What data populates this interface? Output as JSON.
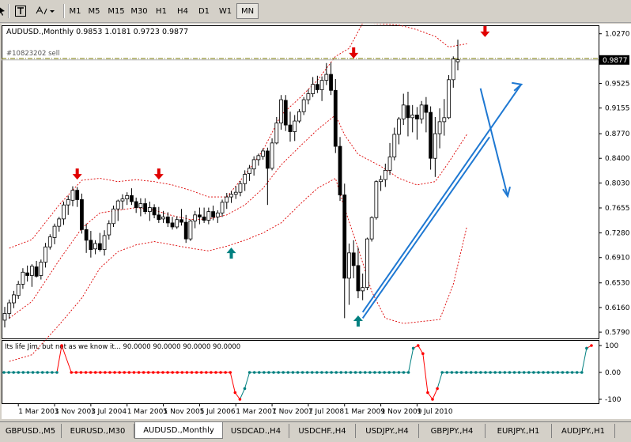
{
  "toolbar": {
    "timeframes": [
      "M1",
      "M5",
      "M15",
      "M30",
      "H1",
      "H4",
      "D1",
      "W1",
      "MN"
    ],
    "active_timeframe": "MN"
  },
  "chart_header": {
    "symbol": "AUDUSD.,Monthly",
    "ohlc": "0.9853 1.0181 0.9723 0.9877",
    "order_label": "#10823202 sell",
    "current_price": "0.9877"
  },
  "indicator": {
    "label": "Its life Jim, but not as we know it...",
    "values": "90.0000 90.0000 90.0000 90.0000"
  },
  "chart_data": {
    "type": "candlestick",
    "price_axis_ticks": [
      "1.0270",
      "0.9877",
      "0.9525",
      "0.9155",
      "0.8770",
      "0.8400",
      "0.8030",
      "0.7655",
      "0.7280",
      "0.6910",
      "0.6530",
      "0.6160",
      "0.5790"
    ],
    "indicator_axis_ticks": [
      "100",
      "0.00",
      "-100"
    ],
    "x_tick_labels": [
      "1 Mar 2003",
      "1 Nov 2003",
      "1 Jul 2004",
      "1 Mar 2005",
      "1 Nov 2005",
      "1 Jul 2006",
      "1 Mar 2007",
      "1 Nov 2007",
      "1 Jul 2008",
      "1 Mar 2009",
      "1 Nov 2009",
      "1 Jul 2010"
    ],
    "start_month": "2002-12",
    "candles": [
      [
        0.597,
        0.617,
        0.586,
        0.607
      ],
      [
        0.607,
        0.628,
        0.599,
        0.623
      ],
      [
        0.623,
        0.641,
        0.615,
        0.635
      ],
      [
        0.634,
        0.656,
        0.629,
        0.651
      ],
      [
        0.651,
        0.675,
        0.644,
        0.669
      ],
      [
        0.668,
        0.679,
        0.655,
        0.664
      ],
      [
        0.664,
        0.681,
        0.647,
        0.678
      ],
      [
        0.677,
        0.686,
        0.661,
        0.663
      ],
      [
        0.664,
        0.688,
        0.658,
        0.684
      ],
      [
        0.684,
        0.713,
        0.676,
        0.707
      ],
      [
        0.707,
        0.726,
        0.703,
        0.722
      ],
      [
        0.721,
        0.742,
        0.711,
        0.738
      ],
      [
        0.738,
        0.752,
        0.73,
        0.749
      ],
      [
        0.749,
        0.775,
        0.74,
        0.77
      ],
      [
        0.77,
        0.784,
        0.755,
        0.778
      ],
      [
        0.777,
        0.798,
        0.768,
        0.792
      ],
      [
        0.792,
        0.797,
        0.767,
        0.778
      ],
      [
        0.778,
        0.787,
        0.727,
        0.733
      ],
      [
        0.733,
        0.742,
        0.698,
        0.717
      ],
      [
        0.717,
        0.731,
        0.691,
        0.703
      ],
      [
        0.704,
        0.717,
        0.696,
        0.712
      ],
      [
        0.712,
        0.728,
        0.7,
        0.703
      ],
      [
        0.703,
        0.732,
        0.694,
        0.724
      ],
      [
        0.725,
        0.747,
        0.718,
        0.742
      ],
      [
        0.742,
        0.769,
        0.737,
        0.764
      ],
      [
        0.764,
        0.778,
        0.746,
        0.776
      ],
      [
        0.776,
        0.786,
        0.763,
        0.779
      ],
      [
        0.779,
        0.789,
        0.77,
        0.784
      ],
      [
        0.784,
        0.795,
        0.77,
        0.775
      ],
      [
        0.775,
        0.781,
        0.758,
        0.766
      ],
      [
        0.766,
        0.78,
        0.753,
        0.772
      ],
      [
        0.772,
        0.78,
        0.756,
        0.76
      ],
      [
        0.76,
        0.775,
        0.746,
        0.766
      ],
      [
        0.766,
        0.771,
        0.75,
        0.755
      ],
      [
        0.755,
        0.767,
        0.743,
        0.748
      ],
      [
        0.749,
        0.761,
        0.743,
        0.752
      ],
      [
        0.752,
        0.759,
        0.737,
        0.743
      ],
      [
        0.743,
        0.752,
        0.733,
        0.737
      ],
      [
        0.737,
        0.753,
        0.734,
        0.748
      ],
      [
        0.748,
        0.764,
        0.739,
        0.744
      ],
      [
        0.744,
        0.755,
        0.713,
        0.719
      ],
      [
        0.719,
        0.748,
        0.716,
        0.746
      ],
      [
        0.746,
        0.761,
        0.735,
        0.755
      ],
      [
        0.755,
        0.766,
        0.741,
        0.752
      ],
      [
        0.752,
        0.766,
        0.743,
        0.747
      ],
      [
        0.747,
        0.766,
        0.741,
        0.76
      ],
      [
        0.76,
        0.769,
        0.747,
        0.752
      ],
      [
        0.752,
        0.762,
        0.743,
        0.758
      ],
      [
        0.758,
        0.778,
        0.752,
        0.774
      ],
      [
        0.774,
        0.788,
        0.764,
        0.782
      ],
      [
        0.782,
        0.791,
        0.773,
        0.786
      ],
      [
        0.786,
        0.798,
        0.779,
        0.789
      ],
      [
        0.789,
        0.806,
        0.783,
        0.802
      ],
      [
        0.802,
        0.822,
        0.791,
        0.816
      ],
      [
        0.817,
        0.83,
        0.806,
        0.825
      ],
      [
        0.824,
        0.843,
        0.814,
        0.838
      ],
      [
        0.838,
        0.847,
        0.829,
        0.844
      ],
      [
        0.843,
        0.855,
        0.838,
        0.851
      ],
      [
        0.851,
        0.856,
        0.77,
        0.825
      ],
      [
        0.825,
        0.87,
        0.822,
        0.863
      ],
      [
        0.863,
        0.902,
        0.861,
        0.893
      ],
      [
        0.893,
        0.935,
        0.883,
        0.928
      ],
      [
        0.927,
        0.935,
        0.881,
        0.89
      ],
      [
        0.89,
        0.91,
        0.865,
        0.88
      ],
      [
        0.88,
        0.905,
        0.866,
        0.896
      ],
      [
        0.896,
        0.914,
        0.893,
        0.91
      ],
      [
        0.91,
        0.932,
        0.905,
        0.928
      ],
      [
        0.928,
        0.944,
        0.921,
        0.937
      ],
      [
        0.937,
        0.962,
        0.932,
        0.951
      ],
      [
        0.951,
        0.964,
        0.938,
        0.943
      ],
      [
        0.943,
        0.963,
        0.926,
        0.957
      ],
      [
        0.957,
        0.983,
        0.95,
        0.966
      ],
      [
        0.966,
        0.984,
        0.935,
        0.942
      ],
      [
        0.942,
        0.959,
        0.848,
        0.858
      ],
      [
        0.858,
        0.872,
        0.776,
        0.785
      ],
      [
        0.785,
        0.802,
        0.6,
        0.66
      ],
      [
        0.66,
        0.712,
        0.62,
        0.698
      ],
      [
        0.698,
        0.717,
        0.66,
        0.679
      ],
      [
        0.679,
        0.706,
        0.63,
        0.641
      ],
      [
        0.641,
        0.667,
        0.627,
        0.646
      ],
      [
        0.646,
        0.721,
        0.642,
        0.719
      ],
      [
        0.719,
        0.753,
        0.715,
        0.751
      ],
      [
        0.751,
        0.807,
        0.748,
        0.805
      ],
      [
        0.805,
        0.814,
        0.791,
        0.808
      ],
      [
        0.808,
        0.832,
        0.797,
        0.822
      ],
      [
        0.822,
        0.863,
        0.815,
        0.842
      ],
      [
        0.842,
        0.886,
        0.837,
        0.876
      ],
      [
        0.876,
        0.902,
        0.861,
        0.899
      ],
      [
        0.899,
        0.937,
        0.89,
        0.92
      ],
      [
        0.919,
        0.94,
        0.873,
        0.901
      ],
      [
        0.901,
        0.92,
        0.879,
        0.905
      ],
      [
        0.905,
        0.917,
        0.868,
        0.899
      ],
      [
        0.899,
        0.926,
        0.892,
        0.92
      ],
      [
        0.92,
        0.932,
        0.879,
        0.909
      ],
      [
        0.909,
        0.918,
        0.823,
        0.84
      ],
      [
        0.84,
        0.902,
        0.812,
        0.877
      ],
      [
        0.877,
        0.915,
        0.855,
        0.895
      ],
      [
        0.895,
        0.929,
        0.874,
        0.901
      ],
      [
        0.901,
        0.965,
        0.899,
        0.958
      ],
      [
        0.958,
        0.993,
        0.946,
        0.989
      ],
      [
        0.985,
        1.018,
        0.972,
        0.988
      ]
    ],
    "bollinger": {
      "upper_points": [
        [
          1,
          0.705
        ],
        [
          6,
          0.718
        ],
        [
          12,
          0.77
        ],
        [
          17,
          0.807
        ],
        [
          21,
          0.81
        ],
        [
          25,
          0.805
        ],
        [
          29,
          0.808
        ],
        [
          33,
          0.805
        ],
        [
          37,
          0.8
        ],
        [
          41,
          0.792
        ],
        [
          45,
          0.782
        ],
        [
          49,
          0.782
        ],
        [
          53,
          0.815
        ],
        [
          57,
          0.852
        ],
        [
          61,
          0.905
        ],
        [
          65,
          0.93
        ],
        [
          69,
          0.957
        ],
        [
          73,
          0.993
        ],
        [
          76,
          1.005
        ],
        [
          79,
          1.043
        ],
        [
          83,
          1.042
        ],
        [
          87,
          1.04
        ],
        [
          91,
          1.033
        ],
        [
          95,
          1.023
        ],
        [
          98,
          1.007
        ],
        [
          102,
          1.012
        ]
      ],
      "middle_points": [
        [
          1,
          0.6
        ],
        [
          6,
          0.625
        ],
        [
          12,
          0.687
        ],
        [
          17,
          0.735
        ],
        [
          21,
          0.758
        ],
        [
          25,
          0.762
        ],
        [
          29,
          0.766
        ],
        [
          33,
          0.762
        ],
        [
          37,
          0.754
        ],
        [
          41,
          0.748
        ],
        [
          45,
          0.749
        ],
        [
          49,
          0.755
        ],
        [
          53,
          0.77
        ],
        [
          57,
          0.795
        ],
        [
          61,
          0.83
        ],
        [
          65,
          0.857
        ],
        [
          69,
          0.883
        ],
        [
          73,
          0.905
        ],
        [
          75,
          0.875
        ],
        [
          78,
          0.846
        ],
        [
          83,
          0.828
        ],
        [
          87,
          0.81
        ],
        [
          91,
          0.8
        ],
        [
          95,
          0.805
        ],
        [
          98,
          0.834
        ],
        [
          102,
          0.876
        ]
      ],
      "lower_points": [
        [
          1,
          0.535
        ],
        [
          6,
          0.545
        ],
        [
          12,
          0.59
        ],
        [
          17,
          0.63
        ],
        [
          21,
          0.675
        ],
        [
          25,
          0.7
        ],
        [
          29,
          0.71
        ],
        [
          33,
          0.715
        ],
        [
          37,
          0.71
        ],
        [
          41,
          0.705
        ],
        [
          45,
          0.701
        ],
        [
          49,
          0.708
        ],
        [
          53,
          0.717
        ],
        [
          57,
          0.728
        ],
        [
          61,
          0.743
        ],
        [
          65,
          0.77
        ],
        [
          69,
          0.795
        ],
        [
          73,
          0.81
        ],
        [
          75,
          0.765
        ],
        [
          78,
          0.705
        ],
        [
          81,
          0.64
        ],
        [
          84,
          0.6
        ],
        [
          88,
          0.592
        ],
        [
          92,
          0.595
        ],
        [
          96,
          0.598
        ],
        [
          99,
          0.651
        ],
        [
          102,
          0.738
        ]
      ]
    },
    "down_arrows": [
      [
        16,
        0.808
      ],
      [
        34,
        0.808
      ],
      [
        77,
        0.99
      ],
      [
        106,
        1.022
      ]
    ],
    "up_arrows": [
      [
        50,
        0.706
      ],
      [
        78,
        0.604
      ]
    ],
    "horizontal_lines": {
      "order": 0.9898,
      "current": 0.9877
    },
    "trend_lines": [
      {
        "from": [
          79,
          0.6
        ],
        "to": [
          107,
          0.872
        ]
      },
      {
        "from": [
          79,
          0.609
        ],
        "to": [
          114,
          0.951
        ]
      },
      {
        "from": [
          105,
          0.945
        ],
        "to": [
          111,
          0.783
        ]
      }
    ],
    "indicator_series": [
      {
        "start": 0,
        "end": 11,
        "value": 0,
        "color": "#008080"
      },
      {
        "start": 12,
        "end": 12,
        "value": 100,
        "color": "#ff0000"
      },
      {
        "start": 14,
        "end": 47,
        "value": 0,
        "color": "#ff0000"
      },
      {
        "start": 48,
        "end": 48,
        "value": -75,
        "color": "#ff0000"
      },
      {
        "start": 49,
        "end": 49,
        "value": -100,
        "color": "#ff0000"
      },
      {
        "start": 50,
        "end": 50,
        "value": -60,
        "color": "#008080"
      },
      {
        "start": 51,
        "end": 84,
        "value": 0,
        "color": "#008080"
      },
      {
        "start": 85,
        "end": 85,
        "value": 90,
        "color": "#008080"
      },
      {
        "start": 86,
        "end": 86,
        "value": 100,
        "color": "#ff0000"
      },
      {
        "start": 87,
        "end": 87,
        "value": 70,
        "color": "#ff0000"
      },
      {
        "start": 88,
        "end": 88,
        "value": -75,
        "color": "#ff0000"
      },
      {
        "start": 89,
        "end": 89,
        "value": -100,
        "color": "#ff0000"
      },
      {
        "start": 90,
        "end": 90,
        "value": -60,
        "color": "#ff0000"
      },
      {
        "start": 91,
        "end": 120,
        "value": 0,
        "color": "#008080"
      },
      {
        "start": 121,
        "end": 121,
        "value": 90,
        "color": "#008080"
      },
      {
        "start": 122,
        "end": 122,
        "value": 100,
        "color": "#ff0000"
      }
    ]
  },
  "tabs": [
    {
      "label": "GBPUSD.,M5",
      "active": false
    },
    {
      "label": "EURUSD.,M30",
      "active": false
    },
    {
      "label": "AUDUSD.,Monthly",
      "active": true
    },
    {
      "label": "USDCAD.,H4",
      "active": false
    },
    {
      "label": "USDCHF.,H4",
      "active": false
    },
    {
      "label": "USDJPY.,H4",
      "active": false
    },
    {
      "label": "GBPJPY.,H4",
      "active": false
    },
    {
      "label": "EURJPY.,H1",
      "active": false
    },
    {
      "label": "AUDJPY.,H1",
      "active": false
    }
  ],
  "colors": {
    "up_arrow": "#008080",
    "down_arrow": "#e00000",
    "bands": "#dd0000",
    "trendline": "#1e78d2",
    "order_line": "#7a7a00"
  }
}
